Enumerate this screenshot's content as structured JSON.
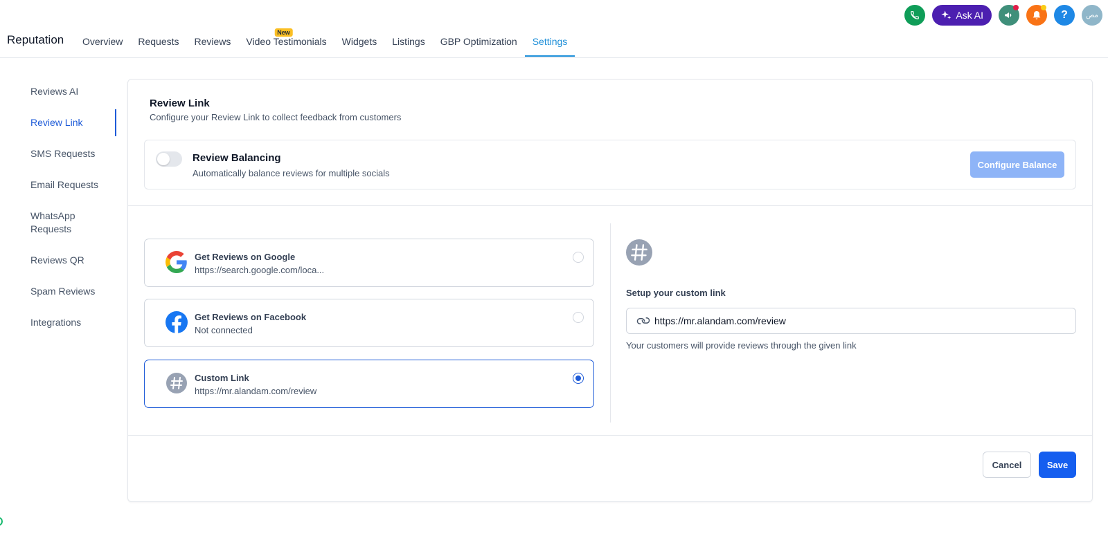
{
  "header": {
    "brand": "Reputation",
    "nav": [
      {
        "label": "Overview",
        "active": false
      },
      {
        "label": "Requests",
        "active": false
      },
      {
        "label": "Reviews",
        "active": false
      },
      {
        "label": "Video Testimonials",
        "active": false,
        "badge": "New"
      },
      {
        "label": "Widgets",
        "active": false
      },
      {
        "label": "Listings",
        "active": false
      },
      {
        "label": "GBP Optimization",
        "active": false
      },
      {
        "label": "Settings",
        "active": true
      }
    ],
    "actions": {
      "ask_ai_label": "Ask AI",
      "help_label": "?",
      "avatar_initials": "مص",
      "phone_color": "#0f9d58",
      "ask_ai_color": "#4c1fb0",
      "announce_color": "#3f8f7a",
      "bell_color": "#f97316",
      "help_color": "#1e88e5"
    }
  },
  "sidebar": {
    "items": [
      {
        "label": "Reviews AI",
        "active": false
      },
      {
        "label": "Review Link",
        "active": true
      },
      {
        "label": "SMS Requests",
        "active": false
      },
      {
        "label": "Email Requests",
        "active": false
      },
      {
        "label": "WhatsApp Requests",
        "active": false
      },
      {
        "label": "Reviews QR",
        "active": false
      },
      {
        "label": "Spam Reviews",
        "active": false
      },
      {
        "label": "Integrations",
        "active": false
      }
    ]
  },
  "main": {
    "title": "Review Link",
    "subtitle": "Configure your Review Link to collect feedback from customers",
    "balancing": {
      "title": "Review Balancing",
      "subtitle": "Automatically balance reviews for multiple socials",
      "enabled": false,
      "configure_label": "Configure Balance"
    },
    "options": [
      {
        "title": "Get Reviews on Google",
        "subtitle": "https://search.google.com/loca...",
        "icon": "google-icon",
        "selected": false
      },
      {
        "title": "Get Reviews on Facebook",
        "subtitle": "Not connected",
        "icon": "facebook-icon",
        "selected": false
      },
      {
        "title": "Custom Link",
        "subtitle": "https://mr.alandam.com/review",
        "icon": "hash-icon",
        "selected": true
      }
    ],
    "custom": {
      "label": "Setup your custom link",
      "value": "https://mr.alandam.com/review",
      "help": "Your customers will provide reviews through the given link"
    },
    "footer": {
      "cancel_label": "Cancel",
      "save_label": "Save"
    }
  }
}
